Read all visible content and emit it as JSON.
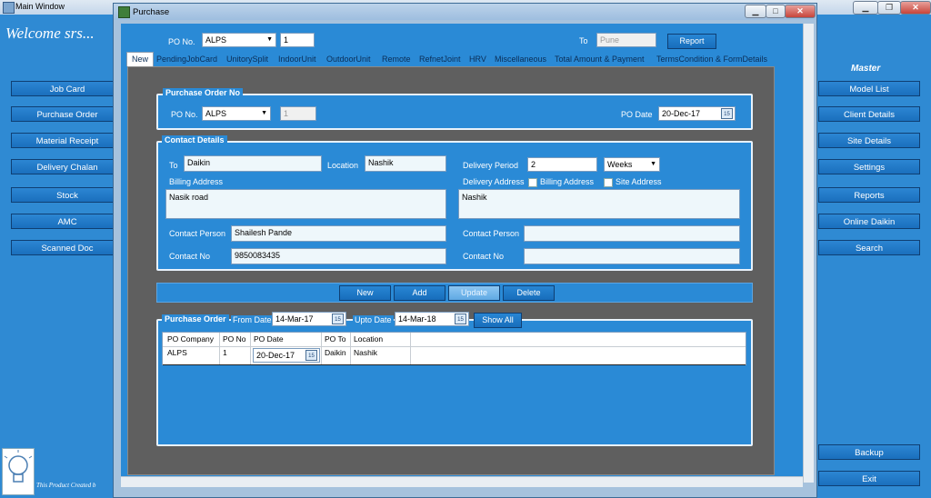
{
  "main": {
    "title": "Main Window",
    "welcome": "Welcome srs...",
    "left_buttons": [
      "Job Card",
      "Purchase Order",
      "Material Receipt",
      "Delivery Chalan",
      "Stock",
      "AMC",
      "Scanned Doc"
    ],
    "master_title": "Master",
    "right_buttons": [
      "Model List",
      "Client Details",
      "Site Details",
      "Settings",
      "Reports",
      "Online Daikin",
      "Search"
    ],
    "bottom_buttons": [
      "Backup",
      "Exit"
    ],
    "footer": "This Product Created b"
  },
  "purchase": {
    "title": "Purchase",
    "top": {
      "po_label": "PO No.",
      "po_company": "ALPS",
      "po_no": "1",
      "to_label": "To",
      "to_value": "Pune",
      "report_label": "Report"
    },
    "tabs": [
      "New",
      "PendingJobCard",
      "UnitorySplit",
      "IndoorUnit",
      "OutdoorUnit",
      "Remote",
      "RefnetJoint",
      "HRV",
      "Miscellaneous",
      "Total Amount & Payment",
      "TermsCondition & FormDetails"
    ],
    "po_section": {
      "legend": "Purchase Order No",
      "po_label": "PO No.",
      "po_company": "ALPS",
      "po_no": "1",
      "date_label": "PO Date",
      "date": "20-Dec-17"
    },
    "contact": {
      "legend": "Contact Details",
      "to_label": "To",
      "to_value": "Daikin",
      "location_label": "Location",
      "location_value": "Nashik",
      "delivery_period_label": "Delivery Period",
      "delivery_period_value": "2",
      "delivery_unit": "Weeks",
      "billing_label": "Billing Address",
      "billing_value": "Nasik road",
      "delivery_address_label": "Delivery Address",
      "billing_chk_label": "Billing Address",
      "site_chk_label": "Site Address",
      "delivery_address_value": "Nashik",
      "contact_person_label": "Contact Person",
      "contact_person_value": "Shailesh Pande",
      "contact_no_label": "Contact No",
      "contact_no_value": "9850083435",
      "contact_person2_label": "Contact Person",
      "contact_no2_label": "Contact No"
    },
    "actions": [
      "New",
      "Add",
      "Update",
      "Delete"
    ],
    "list": {
      "legend": "Purchase Order",
      "from_label": "From Date",
      "from_date": "14-Mar-17",
      "upto_label": "Upto Date",
      "upto_date": "14-Mar-18",
      "show_all": "Show All",
      "columns": [
        "PO Company",
        "PO No",
        "PO Date",
        "PO To",
        "Location"
      ],
      "rows": [
        [
          "ALPS",
          "1",
          "20-Dec-17",
          "Daikin",
          "Nashik"
        ]
      ]
    }
  }
}
